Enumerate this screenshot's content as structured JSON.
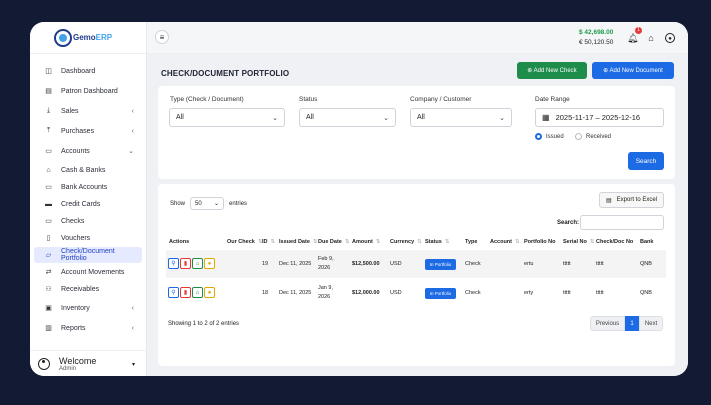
{
  "app": {
    "logo_text_a": "Gemo",
    "logo_text_b": "ERP"
  },
  "topbar": {
    "balance_usd": "$ 42,698.00",
    "balance_eur": "€ 50,120.50",
    "notification_count": "1"
  },
  "sidebar": {
    "items": [
      {
        "label": "Dashboard",
        "icon": "dashboard-icon",
        "chev": ""
      },
      {
        "label": "Patron Dashboard",
        "icon": "chart-icon",
        "chev": ""
      },
      {
        "label": "Sales",
        "icon": "download-icon",
        "chev": "‹"
      },
      {
        "label": "Purchases",
        "icon": "upload-icon",
        "chev": "‹"
      },
      {
        "label": "Accounts",
        "icon": "wallet-icon",
        "chev": "⌄"
      },
      {
        "label": "Cash & Banks",
        "icon": "bank-icon",
        "chev": ""
      },
      {
        "label": "Bank Accounts",
        "icon": "card-icon",
        "chev": ""
      },
      {
        "label": "Credit Cards",
        "icon": "credit-card-icon",
        "chev": ""
      },
      {
        "label": "Checks",
        "icon": "check-icon",
        "chev": ""
      },
      {
        "label": "Vouchers",
        "icon": "voucher-icon",
        "chev": ""
      },
      {
        "label": "Check/Document Portfolio",
        "icon": "folder-icon",
        "chev": ""
      },
      {
        "label": "Account Movements",
        "icon": "transfer-icon",
        "chev": ""
      },
      {
        "label": "Receivables",
        "icon": "users-icon",
        "chev": ""
      },
      {
        "label": "Inventory",
        "icon": "box-icon",
        "chev": "‹"
      },
      {
        "label": "Reports",
        "icon": "bar-chart-icon",
        "chev": "‹"
      }
    ],
    "welcome_title": "Welcome",
    "welcome_role": "Admin"
  },
  "page": {
    "title": "CHECK/DOCUMENT PORTFOLIO",
    "new_check_label": "⊕ Add New Check",
    "new_document_label": "⊕ Add New Document"
  },
  "filters": {
    "type_label": "Type (Check / Document)",
    "type_value": "All",
    "status_label": "Status",
    "status_value": "All",
    "company_label": "Company / Customer",
    "company_value": "All",
    "date_label": "Date Range",
    "date_value": "2025-11-17  –  2025-12-16",
    "radio_issued": "Issued",
    "radio_received": "Received",
    "search_label": "Search"
  },
  "table": {
    "show_label": "Show",
    "page_size": "50",
    "entries_label": "entries",
    "export_label": "Export to Excel",
    "search_label": "Search:",
    "headers": [
      "Actions",
      "Our Check",
      "ID",
      "Issued Date",
      "Due Date",
      "Amount",
      "Currency",
      "Status",
      "Type",
      "Account",
      "Portfolio No",
      "Serial No",
      "Check/Doc No",
      "Bank"
    ],
    "rows": [
      {
        "id": "19",
        "issued": "Dec 11, 2025",
        "due_a": "Feb 9,",
        "due_b": "2026",
        "amount": "$12,500.00",
        "currency": "USD",
        "status": "In Portfolio",
        "type": "Check",
        "portfolio": "ertu",
        "serial": "ttttt",
        "checkno": "ttttt",
        "bank": "QNB"
      },
      {
        "id": "18",
        "issued": "Dec 11, 2025",
        "due_a": "Jan 9,",
        "due_b": "2026",
        "amount": "$12,000.00",
        "currency": "USD",
        "status": "In Portfolio",
        "type": "Check",
        "portfolio": "erty",
        "serial": "ttttt",
        "checkno": "ttttt",
        "bank": "QNB"
      }
    ],
    "info": "Showing 1 to 2 of 2 entries",
    "prev_label": "Previous",
    "current_page": "1",
    "next_label": "Next"
  },
  "colors": {
    "primary": "#1c6ae4",
    "success": "#1e8c4a",
    "danger": "#e53935",
    "sidebar_active": "#e6eaff"
  }
}
